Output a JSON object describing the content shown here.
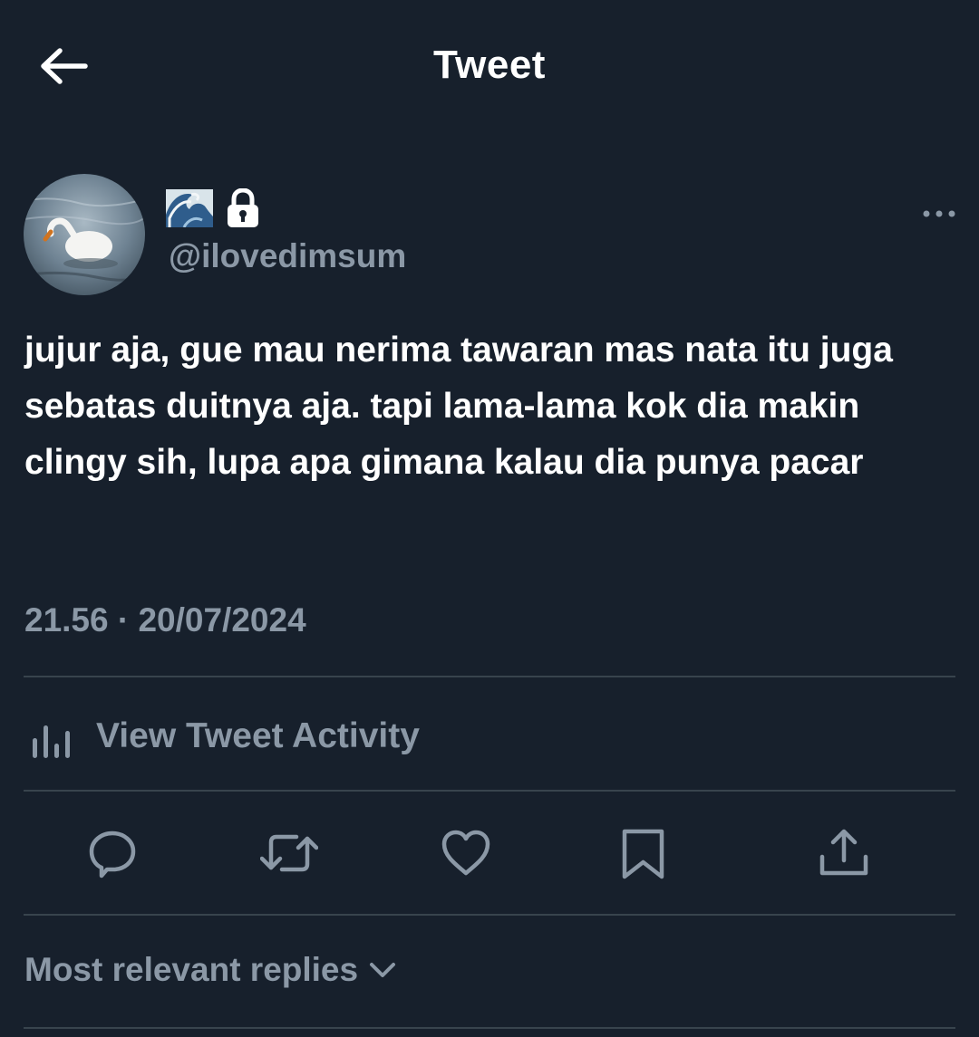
{
  "header": {
    "title": "Tweet",
    "back_icon": "arrow-left-icon"
  },
  "author": {
    "display_name_icons": [
      "water-wave-emoji",
      "lock-icon"
    ],
    "handle": "@ilovedimsum",
    "avatar": "swan-photo-avatar"
  },
  "tweet": {
    "text": "jujur aja, gue mau nerima tawaran mas nata itu juga sebatas duitnya aja. tapi lama-lama kok dia makin clingy sih, lupa apa gimana kalau dia punya pacar",
    "timestamp": "21.56 · 20/07/2024"
  },
  "activity": {
    "label": "View Tweet Activity",
    "icon": "bar-chart-icon"
  },
  "actions": [
    {
      "name": "reply",
      "icon": "reply-icon"
    },
    {
      "name": "retweet",
      "icon": "retweet-icon"
    },
    {
      "name": "like",
      "icon": "heart-icon"
    },
    {
      "name": "bookmark",
      "icon": "bookmark-icon"
    },
    {
      "name": "share",
      "icon": "share-icon"
    }
  ],
  "replies": {
    "sort_label": "Most relevant replies",
    "chevron_icon": "chevron-down-icon"
  },
  "colors": {
    "background": "#17202c",
    "primary_text": "#ffffff",
    "secondary_text": "#8b98a6",
    "divider": "#38444d"
  }
}
